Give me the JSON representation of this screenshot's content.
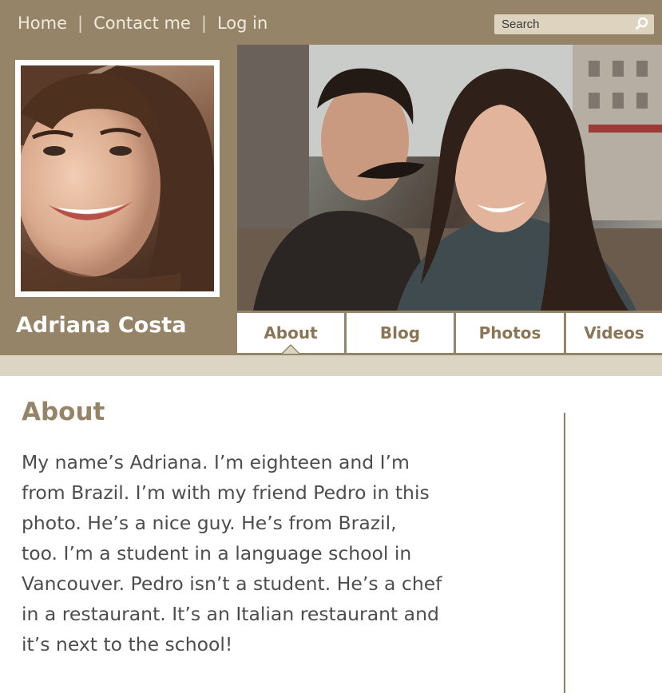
{
  "topnav": {
    "home": "Home",
    "contact": "Contact me",
    "login": "Log in",
    "separator": "|"
  },
  "search": {
    "placeholder": "Search",
    "icon": "search-icon"
  },
  "profile": {
    "name": "Adriana Costa"
  },
  "tabs": [
    {
      "label": "About",
      "active": true
    },
    {
      "label": "Blog",
      "active": false
    },
    {
      "label": "Photos",
      "active": false
    },
    {
      "label": "Videos",
      "active": false
    }
  ],
  "about": {
    "heading": "About",
    "lines": [
      "My name’s Adriana. I’m eighteen and I’m",
      "from Brazil. I’m with my friend Pedro in this",
      "photo. He’s a nice guy. He’s from Brazil,",
      "too. I’m a student in a language school in",
      "Vancouver. Pedro isn’t a student. He’s a chef",
      "in a restaurant. It’s an Italian restaurant and",
      "it’s next to the school!"
    ]
  },
  "colors": {
    "header": "#958468",
    "band": "#ddd5c3",
    "accent": "#958468"
  }
}
